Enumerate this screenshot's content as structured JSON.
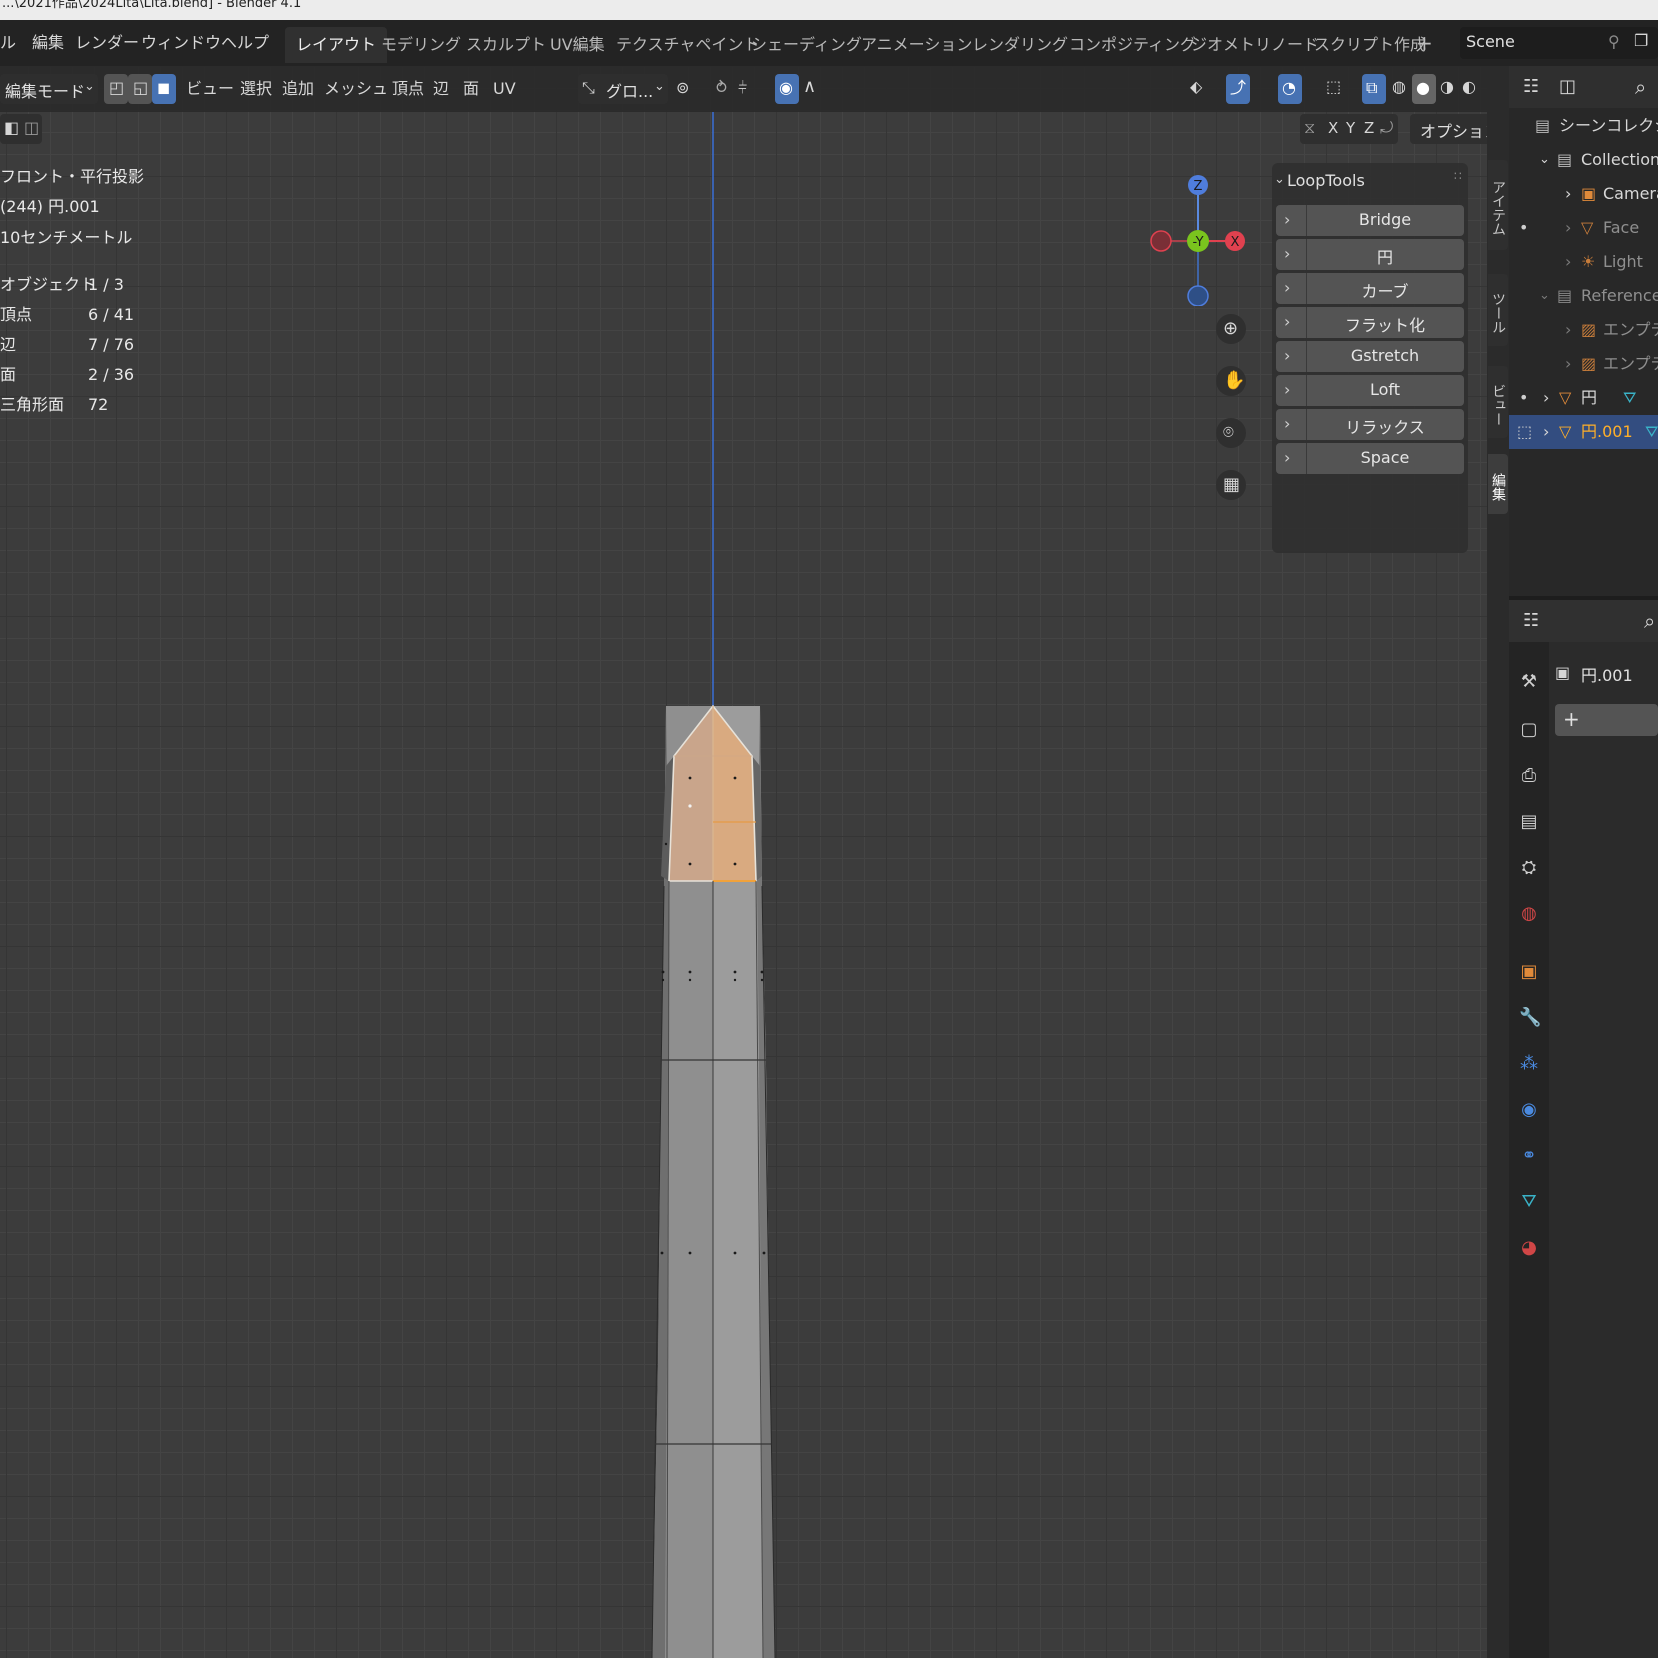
{
  "window_title": "...\\2021作品\\2024Lita\\Lita.blend] - Blender 4.1",
  "menu": [
    "ル",
    "編集",
    "レンダー",
    "ウィンドウ",
    "ヘルプ"
  ],
  "workspace_tabs": [
    "レイアウト",
    "モデリング",
    "スカルプト",
    "UV編集",
    "テクスチャペイント",
    "シェーディング",
    "アニメーション",
    "レンダリング",
    "コンポジティング",
    "ジオメトリノード",
    "スクリプト作成"
  ],
  "workspace_add": "+",
  "scene_name": "Scene",
  "viewport_header": {
    "mode": "編集モード",
    "menus": [
      "ビュー",
      "選択",
      "追加",
      "メッシュ",
      "頂点",
      "辺",
      "面",
      "UV"
    ],
    "transform_orientation": "グロ...",
    "options": "オプション",
    "axes": [
      "X",
      "Y",
      "Z"
    ]
  },
  "overlay": {
    "view": "フロント・平行投影",
    "object": "(244) 円.001",
    "scale": "10センチメートル",
    "stats": [
      {
        "label": "オブジェクト",
        "value": "1 / 3"
      },
      {
        "label": "頂点",
        "value": "6 / 41"
      },
      {
        "label": "辺",
        "value": "7 / 76"
      },
      {
        "label": "面",
        "value": "2 / 36"
      },
      {
        "label": "三角形面",
        "value": "72"
      }
    ]
  },
  "gizmo": {
    "z": "Z",
    "y": "-Y",
    "x": "X"
  },
  "looptools": {
    "title": "LoopTools",
    "items": [
      "Bridge",
      "円",
      "カーブ",
      "フラット化",
      "Gstretch",
      "Loft",
      "リラックス",
      "Space"
    ]
  },
  "side_tabs": [
    "アイテム",
    "ツール",
    "ビュー",
    "編集"
  ],
  "outliner": {
    "root": "シーンコレクション",
    "rows": [
      {
        "label": "Collection",
        "level": 1
      },
      {
        "label": "Camera",
        "level": 2
      },
      {
        "label": "Face",
        "level": 2
      },
      {
        "label": "Light",
        "level": 2
      },
      {
        "label": "Reference",
        "level": 1
      },
      {
        "label": "エンプティ",
        "level": 2
      },
      {
        "label": "エンプティ",
        "level": 2
      },
      {
        "label": "円",
        "level": 1
      },
      {
        "label": "円.001",
        "level": 1
      }
    ]
  },
  "properties": {
    "object_name": "円.001",
    "add": "+"
  },
  "colors": {
    "accent": "#4772b3",
    "selected_face": "#e3a56a",
    "active_orange": "#ffaf29"
  }
}
